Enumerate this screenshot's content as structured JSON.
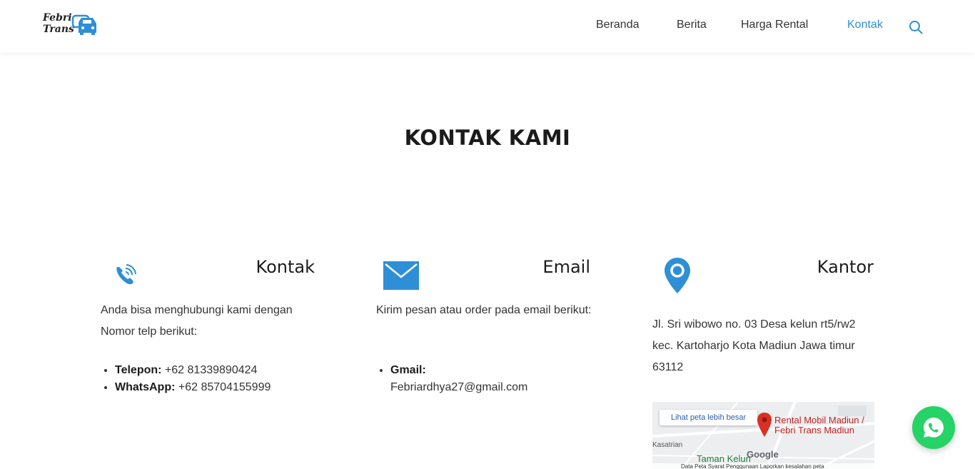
{
  "header": {
    "logo_line1": "Febri",
    "logo_line2": "Trans",
    "nav": [
      {
        "label": "Beranda"
      },
      {
        "label": "Berita"
      },
      {
        "label": "Harga Rental"
      },
      {
        "label": "Kontak"
      }
    ],
    "active_nav": "Kontak",
    "search_icon": "search-icon"
  },
  "main": {
    "title": "KONTAK KAMI"
  },
  "kontak": {
    "icon": "phone-icon",
    "heading": "Kontak",
    "description": "Anda bisa menghubungi kami dengan Nomor telp berikut:",
    "items": [
      {
        "label": "Telepon:",
        "value": "+62 81339890424"
      },
      {
        "label": "WhatsApp:",
        "value": "+62 85704155999"
      }
    ]
  },
  "email": {
    "icon": "envelope-icon",
    "heading": "Email",
    "description": "Kirim pesan atau order pada email berikut:",
    "items": [
      {
        "label": "Gmail:",
        "value": "Febriardhya27@gmail.com"
      }
    ]
  },
  "kantor": {
    "icon": "location-pin-icon",
    "heading": "Kantor",
    "address": "Jl. Sri wibowo no. 03 Desa kelun rt5/rw2 kec. Kartoharjo Kota Madiun Jawa timur 63112",
    "map": {
      "button_label": "Lihat peta lebih besar",
      "place_name": "Rental Mobil Madiun / Febri Trans Madiun",
      "area_label_1": "Kasatrian",
      "area_label_2": "Taman Kelun",
      "brand": "Google",
      "footer": "Data Peta   Syarat Penggunaan   Laporkan kesalahan peta"
    }
  },
  "colors": {
    "accent": "#2f8fd6",
    "whatsapp": "#25d366",
    "pin_red": "#d93025"
  },
  "whatsapp_button": {
    "icon": "whatsapp-icon"
  }
}
